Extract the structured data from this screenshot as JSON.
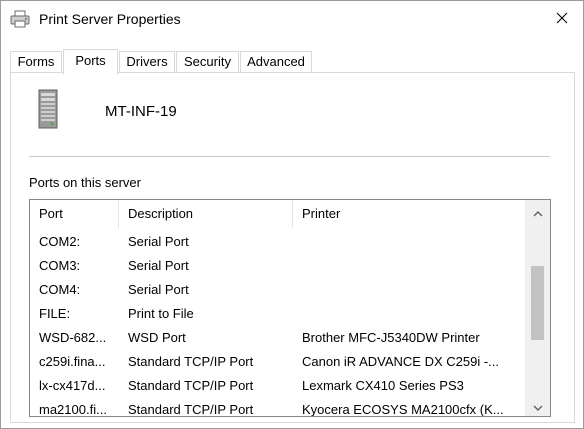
{
  "window": {
    "title": "Print Server Properties",
    "close_glyph": "✕"
  },
  "tabs": [
    {
      "label": "Forms",
      "active": false
    },
    {
      "label": "Ports",
      "active": true
    },
    {
      "label": "Drivers",
      "active": false
    },
    {
      "label": "Security",
      "active": false
    },
    {
      "label": "Advanced",
      "active": false
    }
  ],
  "server": {
    "name": "MT-INF-19",
    "icon": "server-tower-icon"
  },
  "ports_section": {
    "label": "Ports on this server",
    "columns": [
      "Port",
      "Description",
      "Printer"
    ],
    "rows": [
      {
        "port": "COM2:",
        "description": "Serial Port",
        "printer": ""
      },
      {
        "port": "COM3:",
        "description": "Serial Port",
        "printer": ""
      },
      {
        "port": "COM4:",
        "description": "Serial Port",
        "printer": ""
      },
      {
        "port": "FILE:",
        "description": "Print to File",
        "printer": ""
      },
      {
        "port": "WSD-682...",
        "description": "WSD Port",
        "printer": "Brother MFC-J5340DW Printer"
      },
      {
        "port": "c259i.fina...",
        "description": "Standard TCP/IP Port",
        "printer": "Canon iR ADVANCE DX C259i -..."
      },
      {
        "port": "lx-cx417d...",
        "description": "Standard TCP/IP Port",
        "printer": "Lexmark CX410 Series PS3"
      },
      {
        "port": "ma2100.fi...",
        "description": "Standard TCP/IP Port",
        "printer": "Kyocera ECOSYS MA2100cfx (K..."
      }
    ]
  },
  "colors": {
    "border": "#828790",
    "tab_border": "#d9d9d9",
    "scroll_track": "#f0f0f0",
    "scroll_thumb": "#c2c2c2"
  }
}
